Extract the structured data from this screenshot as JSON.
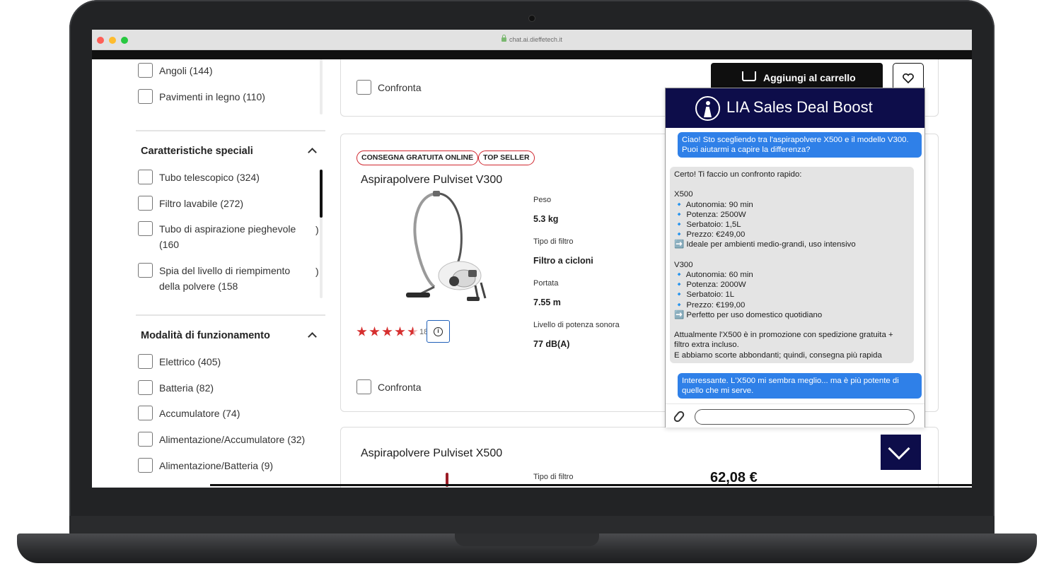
{
  "browser": {
    "url": "chat.ai.dieffetech.it"
  },
  "filters": {
    "top_items": [
      {
        "label": "Angoli (144)"
      },
      {
        "label": "Pavimenti in legno (110)"
      }
    ],
    "special": {
      "title": "Caratteristiche speciali",
      "items": [
        {
          "label": "Tubo telescopico (324)"
        },
        {
          "label": "Filtro lavabile (272)"
        },
        {
          "label": "Tubo di aspirazione pieghevole\n(160",
          "trail": ")"
        },
        {
          "label": "Spia del livello di riempimento\ndella polvere (158",
          "trail": ")"
        }
      ]
    },
    "modes": {
      "title": "Modalità di funzionamento",
      "items": [
        {
          "label": "Elettrico (405)"
        },
        {
          "label": "Batteria (82)"
        },
        {
          "label": "Accumulatore (74)"
        },
        {
          "label": "Alimentazione/Accumulatore (32)"
        },
        {
          "label": "Alimentazione/Batteria (9)"
        }
      ]
    }
  },
  "cards": {
    "top": {
      "compare_label": "Confronta",
      "cart_label": "Aggiungi al carrello"
    },
    "v300": {
      "badges": [
        "CONSEGNA GRATUITA ONLINE",
        "TOP SELLER"
      ],
      "title": "Aspirapolvere Pulviset V300",
      "rating": 4.5,
      "rating_count": "18",
      "specs": [
        {
          "label": "Peso",
          "value": "5.3 kg"
        },
        {
          "label": "Tipo di filtro",
          "value": "Filtro a cicloni"
        },
        {
          "label": "Portata",
          "value": "7.55 m"
        },
        {
          "label": "Livello di potenza sonora",
          "value": "77 dB(A)"
        }
      ],
      "compare_label": "Confronta"
    },
    "x500": {
      "title": "Aspirapolvere Pulviset X500",
      "spec_label": "Tipo di filtro",
      "price": "62,08 €"
    }
  },
  "chat": {
    "title": "LIA Sales Deal Boost",
    "messages": [
      {
        "role": "user",
        "text": "Ciao! Sto scegliendo tra l'aspirapolvere X500 e il modello V300.\nPuoi aiutarmi a capire la differenza?"
      },
      {
        "role": "bot",
        "text": "Certo! Ti faccio un confronto rapido:\n\nX500\n🔹 Autonomia: 90 min\n🔹 Potenza: 2500W\n🔹 Serbatoio: 1,5L\n🔹 Prezzo: €249,00\n➡️ Ideale per ambienti medio-grandi, uso intensivo\n\nV300\n🔹 Autonomia: 60 min\n🔹 Potenza: 2000W\n🔹 Serbatoio: 1L\n🔹 Prezzo: €199,00\n➡️ Perfetto per uso domestico quotidiano\n\nAttualmente l'X500 è in promozione con spedizione gratuita +\nfiltro extra incluso.\nE abbiamo scorte abbondanti; quindi, consegna più rapida"
      },
      {
        "role": "user",
        "text": "Interessante. L'X500 mi sembra meglio... ma è più potente di\nquello che mi serve."
      }
    ],
    "input_placeholder": ""
  },
  "colors": {
    "chat_header": "#0d0d4a",
    "user_bubble": "#2f80e8",
    "bot_bubble": "#e4e4e4",
    "badge_border": "#d0272f",
    "star": "#d62f2f"
  }
}
